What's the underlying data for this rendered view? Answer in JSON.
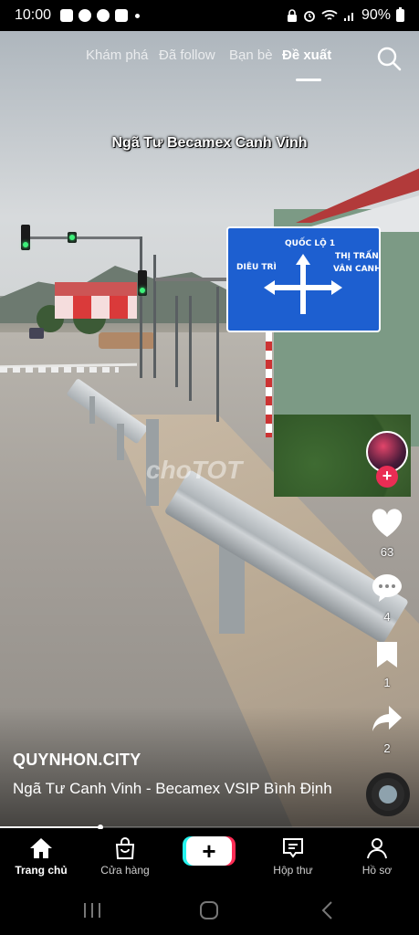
{
  "status_bar": {
    "time": "10:00",
    "battery": "90%",
    "left_icons": [
      "photo-icon",
      "messenger-icon",
      "chrome-icon",
      "h-app-icon",
      "dot-icon"
    ],
    "right_icons": [
      "lock-icon",
      "alarm-icon",
      "wifi-icon",
      "signal-icon",
      "battery-icon"
    ]
  },
  "top_tabs": {
    "items": [
      "Khám phá",
      "Đã follow",
      "Bạn bè",
      "Đề xuất"
    ],
    "active": "Đề xuất"
  },
  "video": {
    "overlay_title": "Ngã Tư Becamex Canh Vinh",
    "watermark": "choTOT",
    "sign": {
      "top": "QUỐC LỘ 1",
      "left": "DIÊU TRÌ",
      "right_line1": "THỊ TRẤN",
      "right_line2": "VÂN CANH"
    }
  },
  "rail": {
    "likes": "63",
    "comments": "4",
    "saves": "1",
    "shares": "2",
    "accent": "#ea2d54"
  },
  "post": {
    "author": "QUYNHON.CITY",
    "caption": "Ngã Tư Canh Vinh - Becamex VSIP Bình Định",
    "progress": 0.24
  },
  "bottom_nav": {
    "items": [
      {
        "label": "Trang chủ",
        "icon": "home-icon",
        "active": true
      },
      {
        "label": "Cửa hàng",
        "icon": "shop-icon",
        "active": false
      },
      {
        "label": "Hộp thư",
        "icon": "inbox-icon",
        "active": false
      },
      {
        "label": "Hồ sơ",
        "icon": "profile-icon",
        "active": false
      }
    ],
    "create_label": "+"
  }
}
